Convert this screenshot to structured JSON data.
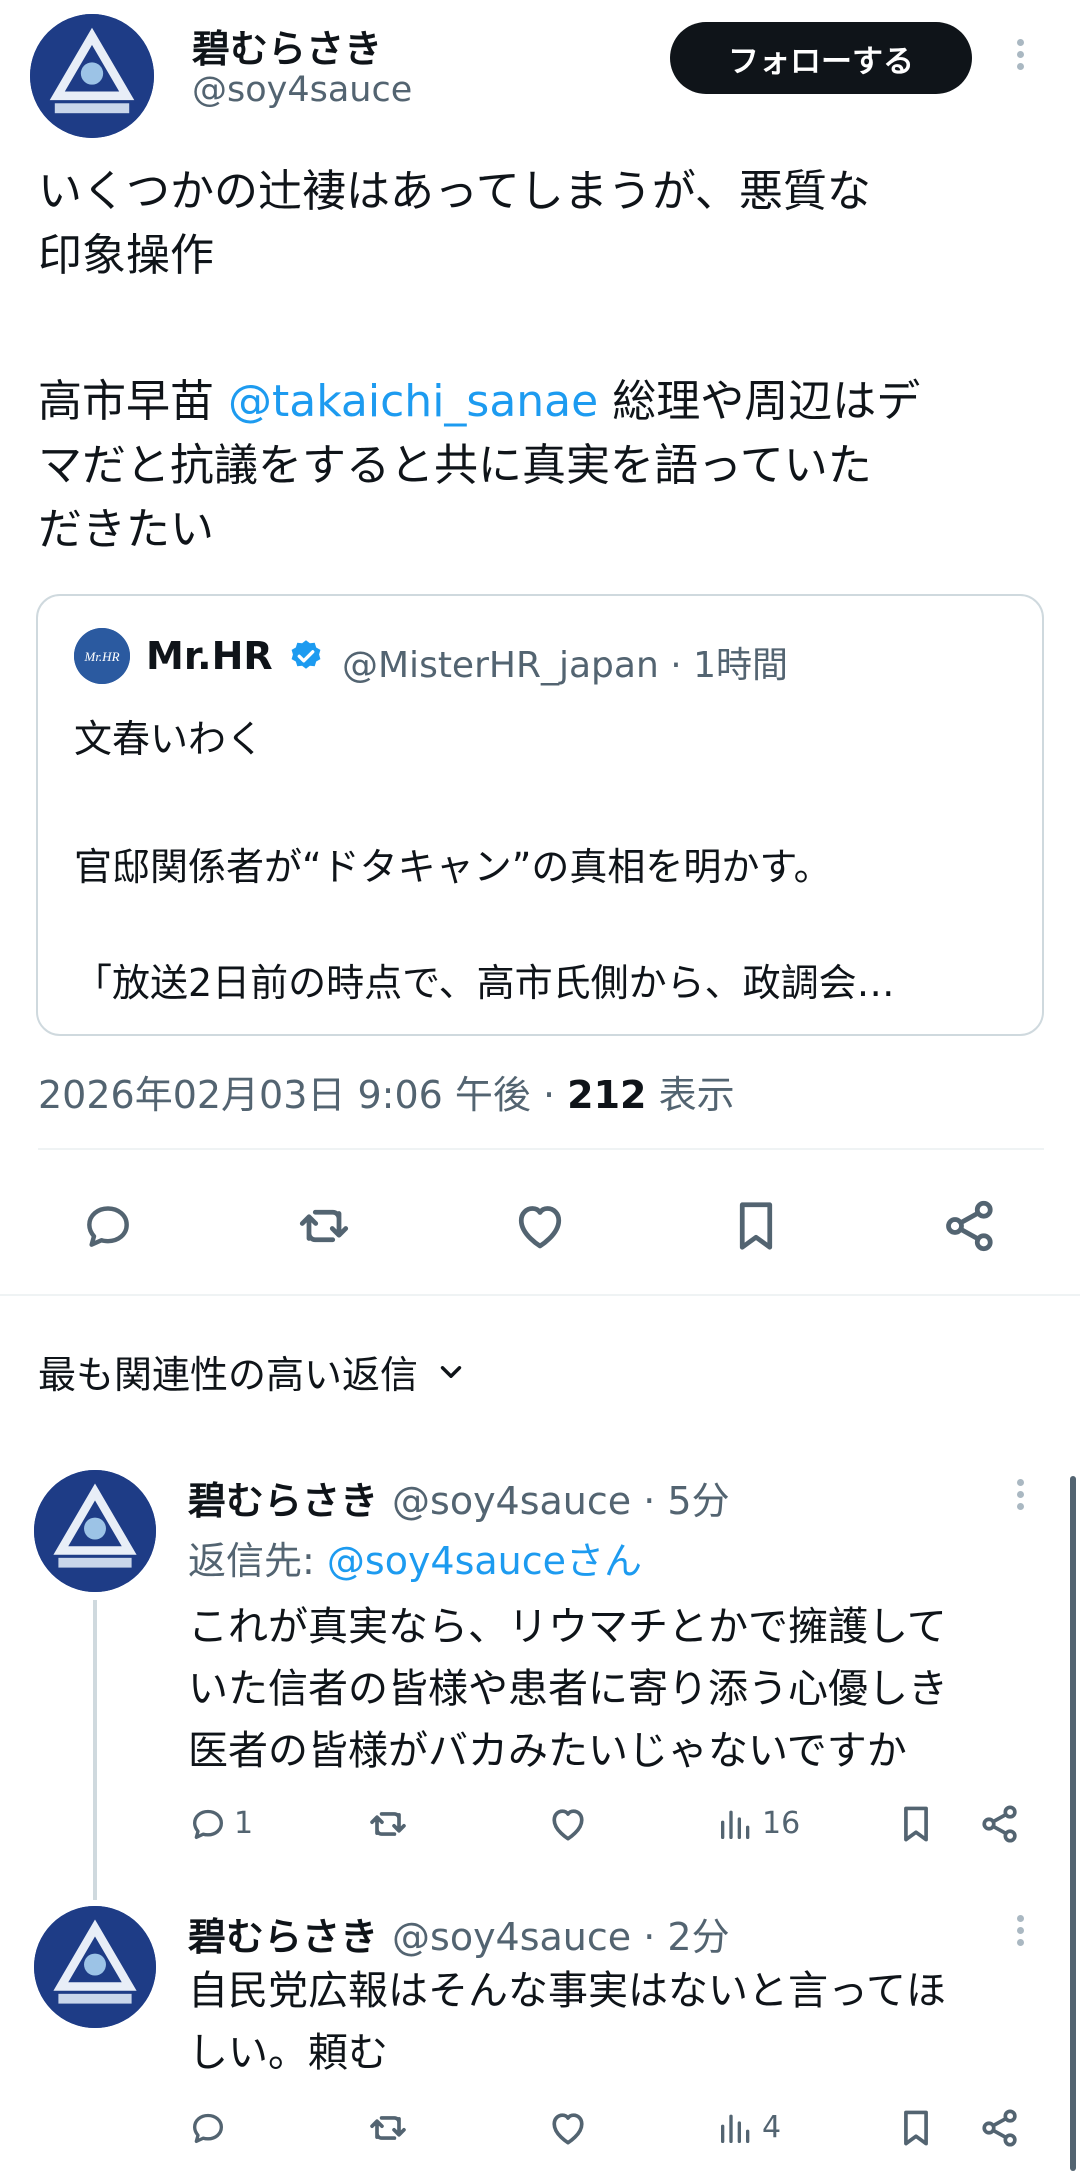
{
  "main_tweet": {
    "author_name": "碧むらさき",
    "author_handle": "@soy4sauce",
    "follow_label": "フォローする",
    "text_line1": "いくつかの辻褄はあってしまうが、悪質な",
    "text_line2": "印象操作",
    "text_line3_pre": "高市早苗 ",
    "text_line3_mention": "@takaichi_sanae",
    "text_line3_post": " 総理や周辺はデ",
    "text_line4": "マだと抗議をすると共に真実を語っていた",
    "text_line5": "だきたい",
    "timestamp": "2026年02月03日 9:06 午後 · ",
    "views_count": "212",
    "views_label": " 表示"
  },
  "quote": {
    "avatar_text": "Mr.HR",
    "author_name": "Mr.HR",
    "handle_time": "@MisterHR_japan · 1時間",
    "line1": "文春いわく",
    "line2": "官邸関係者が“ドタキャン”の真相を明かす。",
    "line3": "「放送2日前の時点で、高市氏側から、政調会…"
  },
  "sort": {
    "label": "最も関連性の高い返信"
  },
  "replies": [
    {
      "author_name": "碧むらさき",
      "meta": "@soy4sauce · 5分",
      "reply_to_prefix": "返信先: ",
      "reply_to_handle": "@soy4sauceさん",
      "line1": "これが真実なら、リウマチとかで擁護して",
      "line2": "いた信者の皆様や患者に寄り添う心優しき",
      "line3": "医者の皆様がバカみたいじゃないですか",
      "reply_count": "1",
      "views": "16"
    },
    {
      "author_name": "碧むらさき",
      "meta": "@soy4sauce · 2分",
      "line1": "自民党広報はそんな事実はないと言ってほ",
      "line2": "しい。頼む",
      "views": "4"
    }
  ],
  "colors": {
    "text": "#0f1419",
    "muted": "#536471",
    "link": "#1d9bf0",
    "verified": "#1d9bf0"
  },
  "icons": [
    "reply-icon",
    "retweet-icon",
    "like-icon",
    "bookmark-icon",
    "share-icon",
    "views-icon",
    "chevron-down-icon",
    "verified-badge-icon",
    "more-icon"
  ]
}
